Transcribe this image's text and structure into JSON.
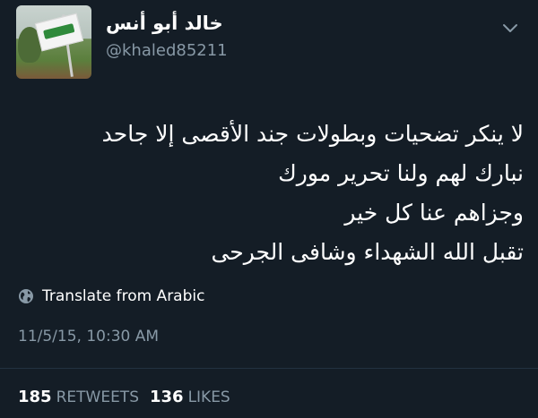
{
  "user": {
    "display_name": "خالد أبو أنس",
    "handle": "@khaled85211"
  },
  "tweet": {
    "lines": [
      "لا ينكر تضحيات وبطولات جند الأقصى إلا جاحد",
      "نبارك لهم ولنا تحرير مورك",
      "وجزاهم عنا كل خير",
      "تقبل الله الشهداء وشافى الجرحى"
    ],
    "translate_label": "Translate from Arabic",
    "timestamp": "11/5/15, 10:30 AM"
  },
  "stats": {
    "retweets_count": "185",
    "retweets_label": "RETWEETS",
    "likes_count": "136",
    "likes_label": "LIKES"
  },
  "icons": {
    "menu": "chevron-down-icon",
    "translate": "globe-icon"
  },
  "colors": {
    "background": "#141d26",
    "text": "#ffffff",
    "secondary_text": "#8899a6",
    "divider": "#233240"
  }
}
